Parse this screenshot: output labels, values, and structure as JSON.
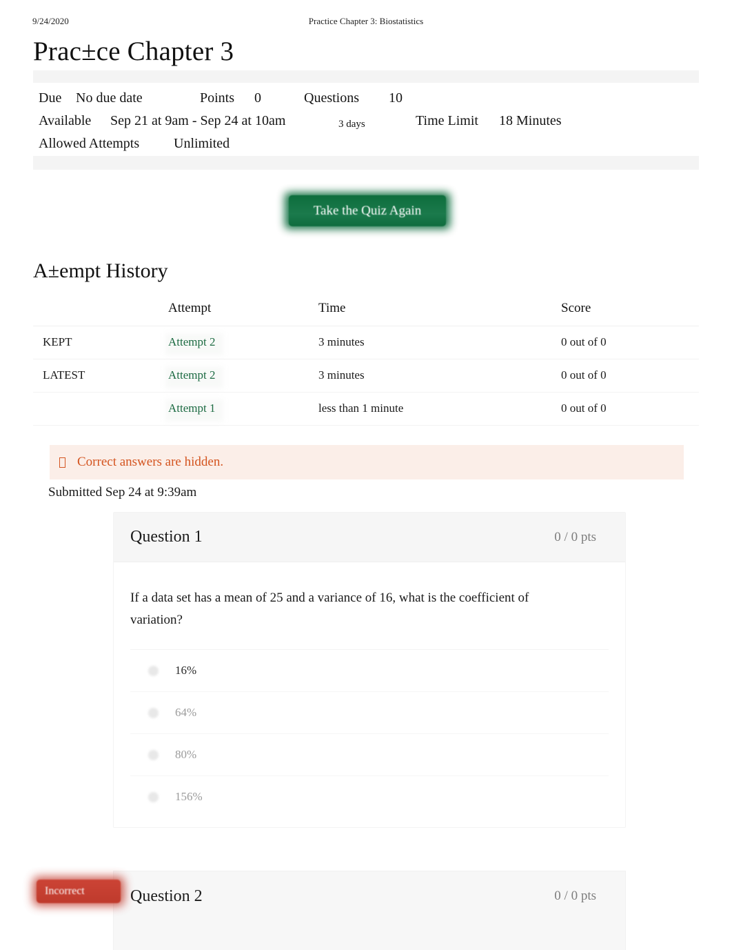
{
  "print_header": {
    "date": "9/24/2020",
    "title": "Practice Chapter 3: Biostatistics"
  },
  "page_title": "Prac±ce Chapter 3",
  "quiz_details": {
    "due_label": "Due",
    "due_value": "No due date",
    "points_label": "Points",
    "points_value": "0",
    "questions_label": "Questions",
    "questions_value": "10",
    "available_label": "Available",
    "available_value": "Sep 21 at 9am - Sep 24 at 10am",
    "available_duration": "3 days",
    "time_limit_label": "Time Limit",
    "time_limit_value": "18 Minutes",
    "allowed_attempts_label": "Allowed Attempts",
    "allowed_attempts_value": "Unlimited"
  },
  "take_quiz_button": "Take the Quiz Again",
  "attempt_history": {
    "section_title": "A±empt History",
    "columns": [
      "",
      "Attempt",
      "Time",
      "Score"
    ],
    "rows": [
      {
        "status": "KEPT",
        "attempt": "Attempt 2",
        "time": "3 minutes",
        "score": "0 out of 0"
      },
      {
        "status": "LATEST",
        "attempt": "Attempt 2",
        "time": "3 minutes",
        "score": "0 out of 0"
      },
      {
        "status": "",
        "attempt": "Attempt 1",
        "time": "less than 1 minute",
        "score": "0 out of 0"
      }
    ]
  },
  "notice": {
    "icon": "warning-icon",
    "text": "Correct answers are hidden."
  },
  "submitted": "Submitted Sep 24 at 9:39am",
  "questions": [
    {
      "title": "Question 1",
      "points": "0 / 0 pts",
      "text": "If a data set has a mean of 25 and a variance of 16, what is the coefficient of variation?",
      "answers": [
        {
          "label": "16%",
          "selected": true
        },
        {
          "label": "64%",
          "selected": false
        },
        {
          "label": "80%",
          "selected": false
        },
        {
          "label": "156%",
          "selected": false
        }
      ]
    },
    {
      "title": "Question 2",
      "points": "0 / 0 pts",
      "badge": "Incorrect"
    }
  ],
  "colors": {
    "brand_green": "#1c6b42",
    "button_green": "#0e6e3d",
    "notice_orange": "#d4541f",
    "notice_bg": "#fbeee8",
    "incorrect_red": "#c23b2e",
    "muted_text": "#9b9b9b"
  }
}
